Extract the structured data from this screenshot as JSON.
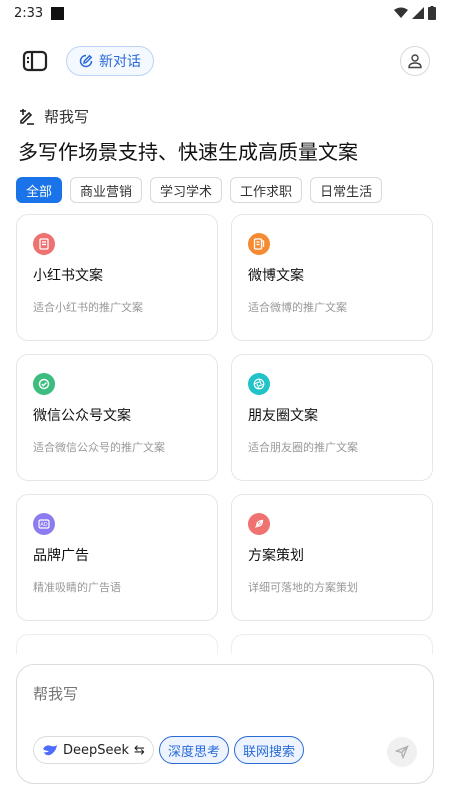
{
  "status_bar": {
    "time": "2:33"
  },
  "header": {
    "new_chat_label": "新对话"
  },
  "section": {
    "label": "帮我写",
    "headline": "多写作场景支持、快速生成高质量文案"
  },
  "tabs": [
    {
      "label": "全部",
      "active": true
    },
    {
      "label": "商业营销",
      "active": false
    },
    {
      "label": "学习学术",
      "active": false
    },
    {
      "label": "工作求职",
      "active": false
    },
    {
      "label": "日常生活",
      "active": false
    }
  ],
  "cards": [
    {
      "title": "小红书文案",
      "desc": "适合小红书的推广文案",
      "icon": "document-icon",
      "color": "#f07270"
    },
    {
      "title": "微博文案",
      "desc": "适合微博的推广文案",
      "icon": "weibo-doc-icon",
      "color": "#f58a32"
    },
    {
      "title": "微信公众号文案",
      "desc": "适合微信公众号的推广文案",
      "icon": "check-badge-icon",
      "color": "#3dbd7d"
    },
    {
      "title": "朋友圈文案",
      "desc": "适合朋友圈的推广文案",
      "icon": "aperture-icon",
      "color": "#21c3c8"
    },
    {
      "title": "品牌广告",
      "desc": "精准吸睛的广告语",
      "icon": "ad-icon",
      "color": "#8a7cf0"
    },
    {
      "title": "方案策划",
      "desc": "详细可落地的方案策划",
      "icon": "rocket-icon",
      "color": "#f07270"
    }
  ],
  "composer": {
    "placeholder": "帮我写",
    "model_label": "DeepSeek",
    "deep_think_label": "深度思考",
    "web_search_label": "联网搜索"
  },
  "colors": {
    "accent": "#1a73e8"
  }
}
